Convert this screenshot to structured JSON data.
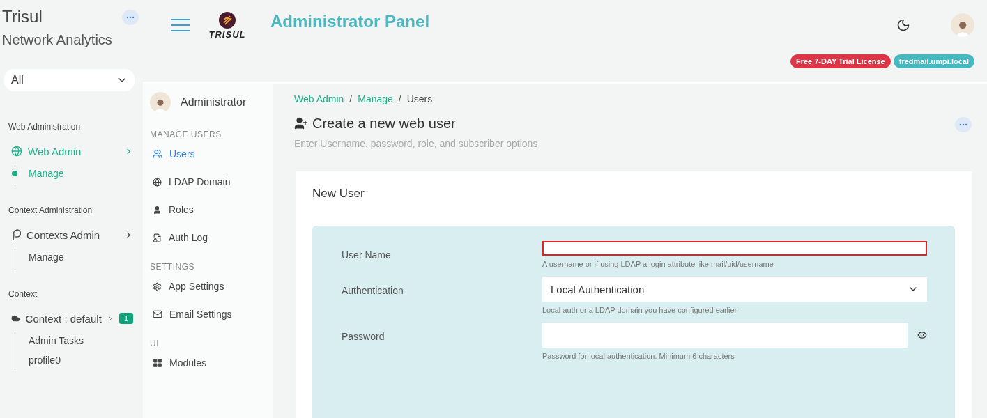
{
  "brand": {
    "title": "Trisul",
    "subtitle": "Network Analytics"
  },
  "context_select": {
    "value": "All"
  },
  "nav_sections": [
    {
      "heading": "Web Administration",
      "items": [
        {
          "label": "Web Admin",
          "selected": true,
          "children": [
            {
              "label": "Manage",
              "selected": true
            }
          ]
        }
      ]
    },
    {
      "heading": "Context Administration",
      "items": [
        {
          "label": "Contexts Admin",
          "selected": false,
          "children": [
            {
              "label": "Manage",
              "selected": false
            }
          ]
        }
      ]
    },
    {
      "heading": "Context",
      "items": [
        {
          "label": "Context : default",
          "selected": false,
          "badge": "1",
          "children": [
            {
              "label": "Admin Tasks",
              "selected": false
            },
            {
              "label": "profile0",
              "selected": false
            }
          ]
        }
      ]
    }
  ],
  "header": {
    "logo_text": "TRISUL",
    "title": "Administrator Panel",
    "badges": [
      {
        "label": "Free 7-DAY Trial License",
        "color": "#dc3545"
      },
      {
        "label": "fredmail.umpi.local",
        "color": "#45b8c0"
      }
    ]
  },
  "submenu": {
    "user": "Administrator",
    "groups": [
      {
        "heading": "MANAGE USERS",
        "items": [
          {
            "label": "Users",
            "selected": true
          },
          {
            "label": "LDAP Domain",
            "selected": false
          },
          {
            "label": "Roles",
            "selected": false
          },
          {
            "label": "Auth Log",
            "selected": false
          }
        ]
      },
      {
        "heading": "SETTINGS",
        "items": [
          {
            "label": "App Settings",
            "selected": false
          },
          {
            "label": "Email Settings",
            "selected": false
          }
        ]
      },
      {
        "heading": "UI",
        "items": [
          {
            "label": "Modules",
            "selected": false
          }
        ]
      }
    ]
  },
  "breadcrumb": [
    {
      "label": "Web Admin",
      "link": true
    },
    {
      "label": "Manage",
      "link": true,
      "separator": "/"
    },
    {
      "label": "Users",
      "link": false,
      "separator": "/"
    }
  ],
  "page": {
    "title": "Create a new web user",
    "subtitle": "Enter Username, password, role, and subscriber options"
  },
  "card": {
    "title": "New User",
    "fields": [
      {
        "kind": "text",
        "label": "User Name",
        "invalid": true,
        "hint": "A username or if using LDAP a login attribute like mail/uid/username"
      },
      {
        "kind": "select",
        "label": "Authentication",
        "value": "Local Authentication",
        "invalid": false,
        "hint": "Local auth or a LDAP domain you have configured earlier"
      },
      {
        "kind": "password",
        "label": "Password",
        "invalid": false,
        "hint": "Password for local authentication. Minimum 6 characters"
      }
    ]
  }
}
